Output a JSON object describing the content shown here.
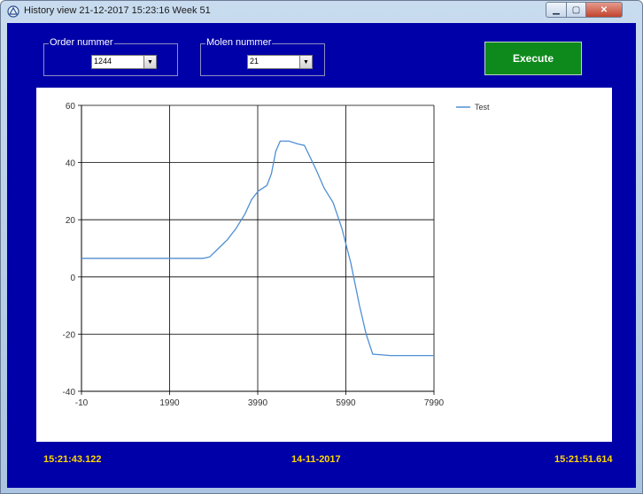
{
  "window": {
    "title": "History view 21-12-2017 15:23:16 Week 51",
    "controls": {
      "minimize": "▁",
      "maximize": "▢",
      "close": "✕"
    },
    "icon": "app-icon"
  },
  "filters": {
    "order": {
      "label": "Order nummer",
      "value": "1244"
    },
    "molen": {
      "label": "Molen nummer",
      "value": "21"
    }
  },
  "execute_label": "Execute",
  "colors": {
    "background": "#0000a8",
    "execute": "#0e8a1c",
    "footer_text": "#ffd700",
    "series": "#4f8fd4"
  },
  "chart_data": {
    "type": "line",
    "title": "",
    "xlabel": "",
    "ylabel": "",
    "xlim": [
      -10,
      7990
    ],
    "ylim": [
      -40,
      60
    ],
    "xticks": [
      "-10",
      "1990",
      "3990",
      "5990",
      "7990"
    ],
    "yticks": [
      "60",
      "40",
      "20",
      "0",
      "-20",
      "-40"
    ],
    "grid": true,
    "legend_position": "top-right",
    "series": [
      {
        "name": "Test",
        "color": "#4f8fd4",
        "x": [
          -10,
          1000,
          2000,
          2750,
          2900,
          3100,
          3300,
          3500,
          3700,
          3850,
          4000,
          4200,
          4300,
          4400,
          4500,
          4700,
          4900,
          5050,
          5300,
          5500,
          5700,
          5900,
          6100,
          6300,
          6450,
          6600,
          7000,
          7990
        ],
        "y": [
          6.5,
          6.5,
          6.5,
          6.5,
          7,
          10,
          13,
          17,
          22,
          27,
          30,
          32,
          36,
          44,
          47.5,
          47.5,
          46.5,
          46,
          38,
          31,
          26,
          17,
          5,
          -10,
          -20,
          -27,
          -27.5,
          -27.5
        ]
      }
    ]
  },
  "footer": {
    "left_time": "15:21:43.122",
    "date": "14-11-2017",
    "right_time": "15:21:51.614"
  }
}
